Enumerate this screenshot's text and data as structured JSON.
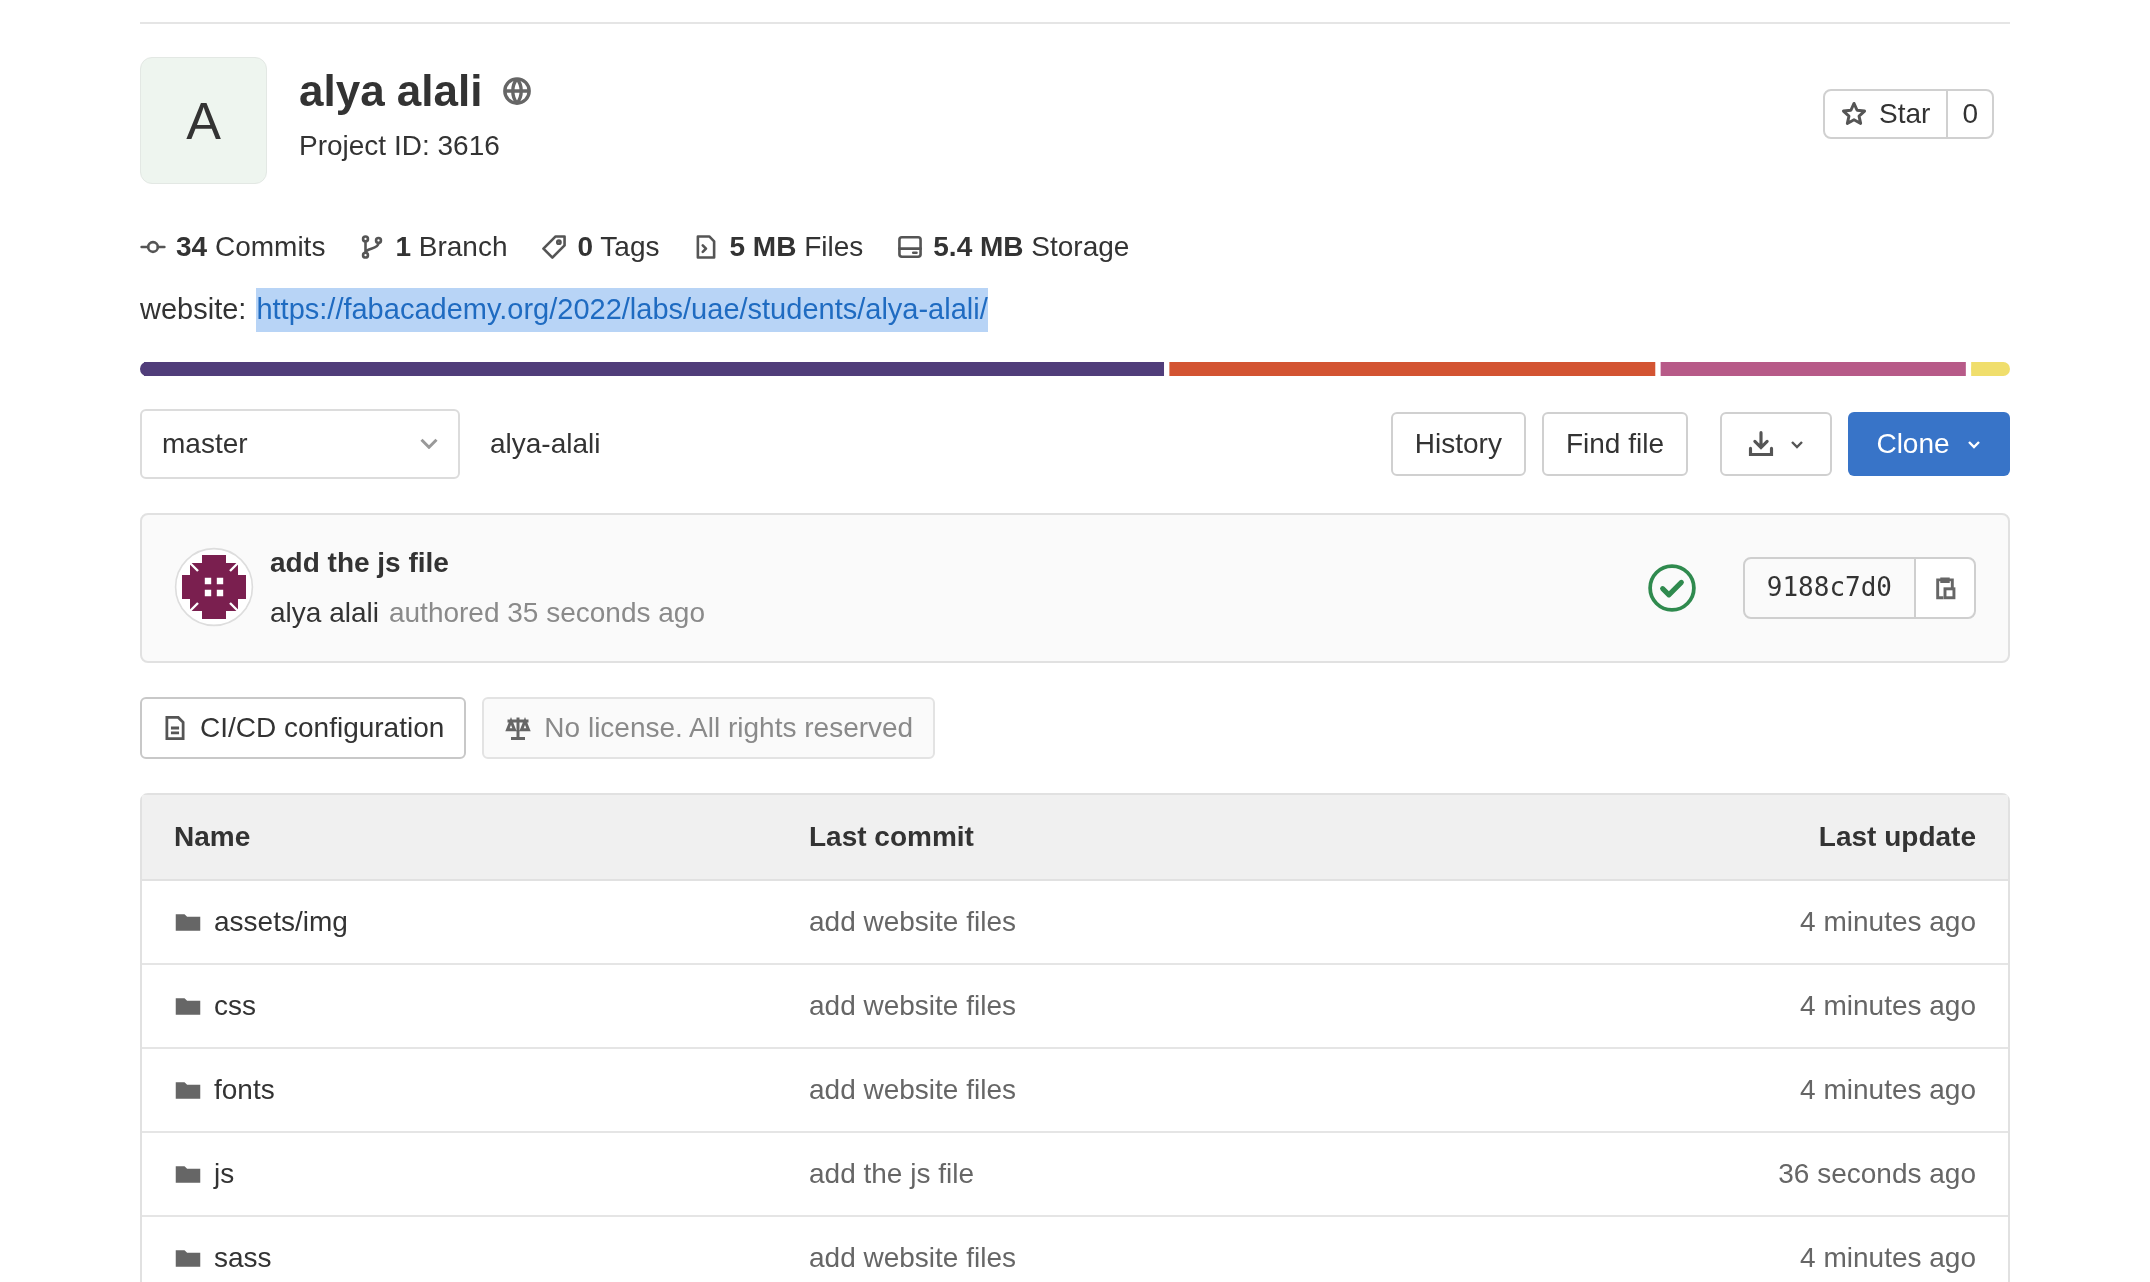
{
  "project": {
    "avatar_letter": "A",
    "name": "alya alali",
    "project_id": "Project ID: 3616"
  },
  "star": {
    "label": "Star",
    "count": "0"
  },
  "stats": [
    {
      "kind": "commits",
      "value": "34",
      "label": "Commits"
    },
    {
      "kind": "branch",
      "value": "1",
      "label": "Branch"
    },
    {
      "kind": "tags",
      "value": "0",
      "label": "Tags"
    },
    {
      "kind": "files",
      "value": "5 MB",
      "label": "Files"
    },
    {
      "kind": "storage",
      "value": "5.4 MB",
      "label": "Storage"
    }
  ],
  "website": {
    "label": "website:",
    "url": "https://fabacademy.org/2022/labs/uae/students/alya-alali/",
    "selected": true
  },
  "branch_select": {
    "value": "master"
  },
  "path": "alya-alali",
  "buttons": {
    "history": "History",
    "find_file": "Find file",
    "clone": "Clone"
  },
  "last_commit": {
    "title": "add the js file",
    "author": "alya alali",
    "meta": "authored 35 seconds ago",
    "sha": "9188c7d0"
  },
  "badges": [
    {
      "kind": "cicd",
      "label": "CI/CD configuration",
      "disabled": false
    },
    {
      "kind": "license",
      "label": "No license. All rights reserved",
      "disabled": true
    }
  ],
  "table": {
    "columns": [
      "Name",
      "Last commit",
      "Last update"
    ],
    "rows": [
      {
        "name": "assets/img",
        "commit": "add website files",
        "updated": "4 minutes ago"
      },
      {
        "name": "css",
        "commit": "add website files",
        "updated": "4 minutes ago"
      },
      {
        "name": "fonts",
        "commit": "add website files",
        "updated": "4 minutes ago"
      },
      {
        "name": "js",
        "commit": "add the js file",
        "updated": "36 seconds ago"
      },
      {
        "name": "sass",
        "commit": "add website files",
        "updated": "4 minutes ago"
      }
    ]
  }
}
